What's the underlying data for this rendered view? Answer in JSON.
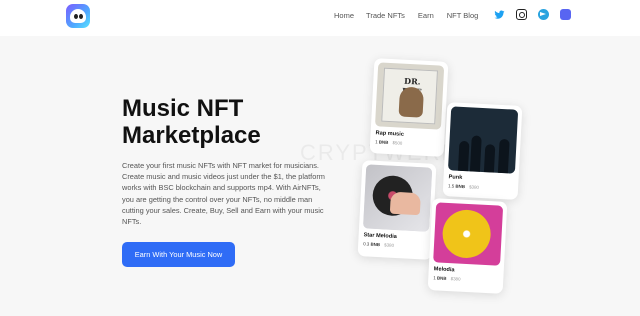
{
  "nav": {
    "links": [
      "Home",
      "Trade NFTs",
      "Earn",
      "NFT Blog"
    ],
    "social": [
      "twitter-icon",
      "instagram-icon",
      "telegram-icon",
      "discord-icon"
    ]
  },
  "hero": {
    "title": "Music NFT Marketplace",
    "description": "Create your first music NFTs with NFT market for musicians. Create music and music videos just under the $1, the platform works with BSC blockchain and supports mp4. With AirNFTs, you are getting the control over your NFTs, no middle man cutting your sales. Create, Buy, Sell and Earn with your music NFTs.",
    "cta": "Earn With Your Music Now"
  },
  "watermark": "CRYPTWERK.COM",
  "cards": [
    {
      "name": "Rap music",
      "price": "1",
      "unit": "BNB",
      "usd": "$500",
      "album_title": "DR. DRE"
    },
    {
      "name": "Punk",
      "price": "1.5",
      "unit": "BNB",
      "usd": "$380"
    },
    {
      "name": "Star Melodia",
      "price": "0.3",
      "unit": "BNB",
      "usd": "$380"
    },
    {
      "name": "Melodia",
      "price": "1",
      "unit": "BNB",
      "usd": "$380"
    }
  ],
  "colors": {
    "accent": "#2f6cf6",
    "twitter": "#1da1f2",
    "telegram": "#2aa3df",
    "discord": "#5865f2"
  }
}
